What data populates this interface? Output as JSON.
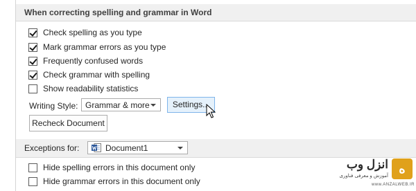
{
  "section_spelling": {
    "title": "When correcting spelling and grammar in Word",
    "options": [
      {
        "label": "Check spelling as you type",
        "checked": true
      },
      {
        "label": "Mark grammar errors as you type",
        "checked": true
      },
      {
        "label": "Frequently confused words",
        "checked": true
      },
      {
        "label": "Check grammar with spelling",
        "checked": true
      },
      {
        "label": "Show readability statistics",
        "checked": false
      }
    ],
    "writing_style_label": "Writing Style:",
    "writing_style_value": "Grammar & more",
    "settings_button": "Settings...",
    "recheck_button": "Recheck Document"
  },
  "section_exceptions": {
    "label": "Exceptions for:",
    "document_value": "Document1",
    "options": [
      {
        "label": "Hide spelling errors in this document only",
        "checked": false
      },
      {
        "label": "Hide grammar errors in this document only",
        "checked": false
      }
    ]
  },
  "watermark": {
    "name": "انزل وب",
    "tagline": "آموزش و معرفی فناوری",
    "url": "www.ANZALWEB.IR",
    "logo_glyph": "ه"
  }
}
